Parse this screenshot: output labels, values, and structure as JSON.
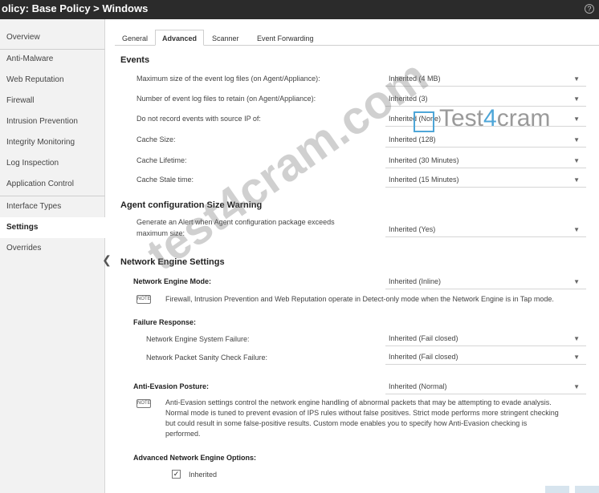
{
  "title": "olicy: Base Policy > Windows",
  "sidebar": {
    "items": [
      "Overview",
      "Anti-Malware",
      "Web Reputation",
      "Firewall",
      "Intrusion Prevention",
      "Integrity Monitoring",
      "Log Inspection",
      "Application Control",
      "Interface Types",
      "Settings",
      "Overrides"
    ],
    "active": "Settings"
  },
  "tabs": [
    "General",
    "Advanced",
    "Scanner",
    "Event Forwarding"
  ],
  "events": {
    "heading": "Events",
    "rows": [
      {
        "label": "Maximum size of the event log files (on Agent/Appliance):",
        "value": "Inherited (4 MB)"
      },
      {
        "label": "Number of event log files to retain (on Agent/Appliance):",
        "value": "Inherited (3)"
      },
      {
        "label": "Do not record events with source IP of:",
        "value": "Inherited (None)"
      },
      {
        "label": "Cache Size:",
        "value": "Inherited (128)"
      },
      {
        "label": "Cache Lifetime:",
        "value": "Inherited (30 Minutes)"
      },
      {
        "label": "Cache Stale time:",
        "value": "Inherited (15 Minutes)"
      }
    ]
  },
  "agent_config": {
    "heading": "Agent configuration Size Warning",
    "label_line1": "Generate an Alert when Agent configuration package exceeds",
    "label_line2": "maximum size:",
    "value": "Inherited (Yes)"
  },
  "network_engine": {
    "heading": "Network Engine Settings",
    "mode_label": "Network Engine Mode:",
    "mode_value": "Inherited (Inline)",
    "note_badge": "NOTE",
    "mode_note": "Firewall, Intrusion Prevention and Web Reputation operate in Detect-only mode when the Network Engine is in Tap mode.",
    "failure_heading": "Failure Response:",
    "system_failure_label": "Network Engine System Failure:",
    "system_failure_value": "Inherited (Fail closed)",
    "packet_check_label": "Network Packet Sanity Check Failure:",
    "packet_check_value": "Inherited (Fail closed)",
    "anti_evasion_label": "Anti-Evasion Posture:",
    "anti_evasion_value": "Inherited (Normal)",
    "anti_note_lines": [
      "Anti-Evasion settings control the network engine handling of abnormal packets that may be attempting to evade analysis.",
      "Normal mode is tuned to prevent evasion of IPS rules without false positives. Strict mode performs more stringent checking",
      "but could result in some false-positive results. Custom mode enables you to specify how Anti-Evasion checking is",
      "performed."
    ],
    "advanced_heading": "Advanced Network Engine Options:",
    "inherited_checkbox_label": "Inherited",
    "inherited_checked": true
  },
  "watermark": "test4cram.com",
  "logo": {
    "prefix": "Test",
    "four": "4",
    "suffix": "cram"
  },
  "icons": {
    "dropdown": "chevron-down-icon",
    "collapse": "chevron-left-icon",
    "help": "help-icon",
    "check": "check-icon"
  },
  "colors": {
    "titlebar": "#2b2b2b",
    "sidebar": "#f2f2f2",
    "logo_accent": "#4ea6d8"
  }
}
